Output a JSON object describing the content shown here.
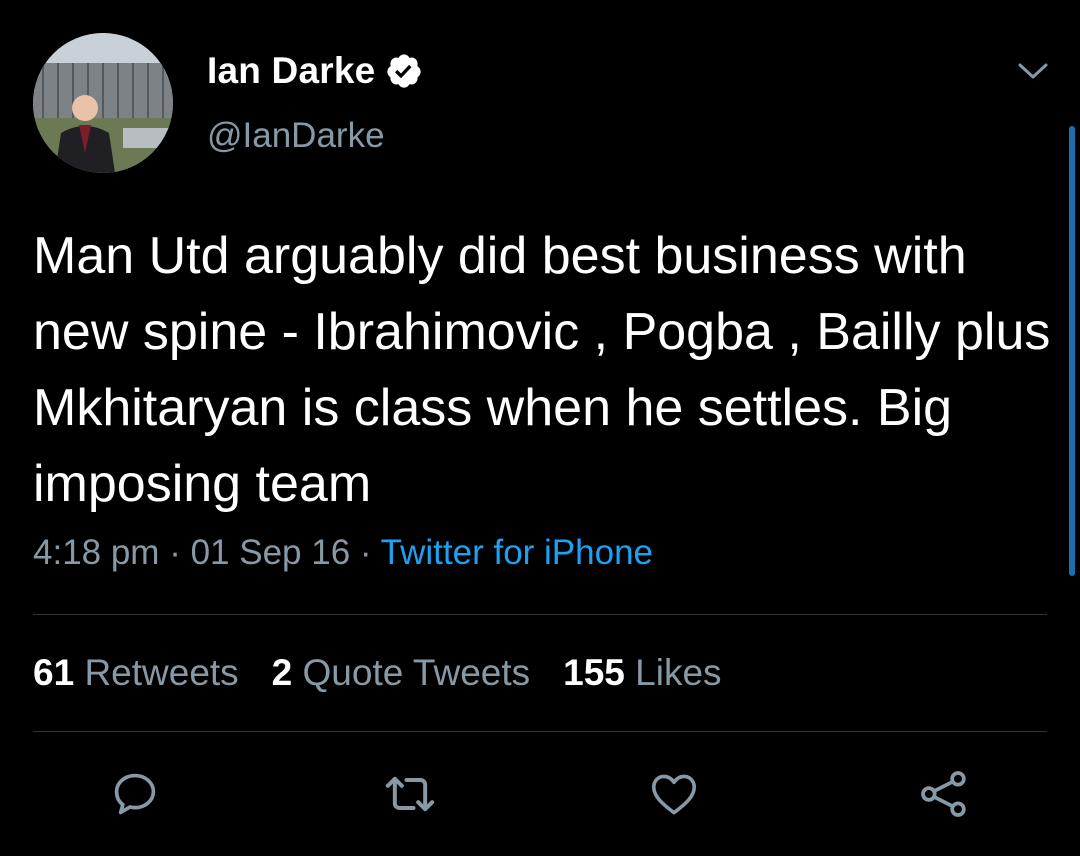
{
  "author": {
    "display_name": "Ian Darke",
    "handle": "@IanDarke",
    "verified": true
  },
  "tweet": {
    "text": "Man Utd arguably did best business with new spine - Ibrahimovic , Pogba , Bailly plus Mkhitaryan is class when he settles. Big imposing team",
    "time": "4:18 pm",
    "date": "01 Sep 16",
    "separator": "·",
    "source": "Twitter for iPhone"
  },
  "stats": {
    "retweets": {
      "count": "61",
      "label": "Retweets"
    },
    "quotes": {
      "count": "2",
      "label": "Quote Tweets"
    },
    "likes": {
      "count": "155",
      "label": "Likes"
    }
  },
  "actions": [
    "reply-icon",
    "retweet-icon",
    "like-icon",
    "share-icon"
  ],
  "colors": {
    "background": "#000000",
    "text": "#ffffff",
    "secondary": "#8899a6",
    "link": "#1da1f2",
    "divider": "#2f3336"
  }
}
